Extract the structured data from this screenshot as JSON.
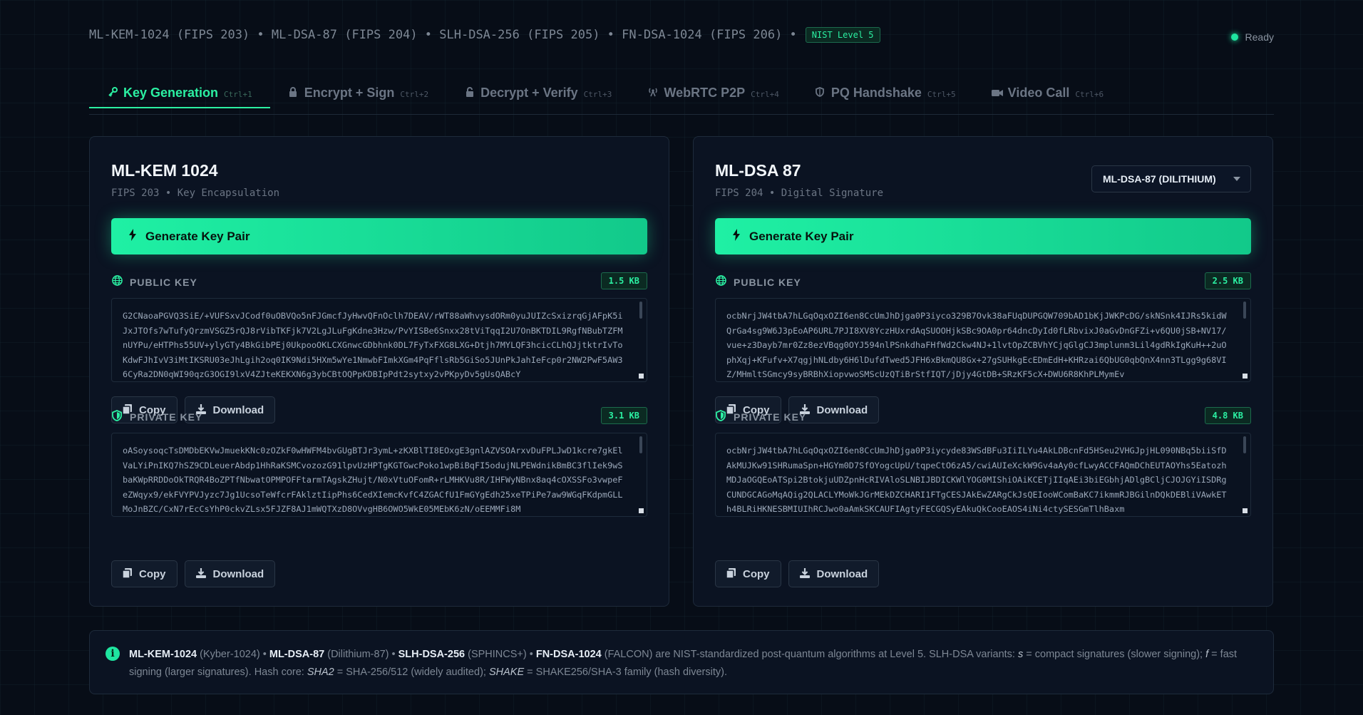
{
  "header": {
    "algorithms_line": "ML-KEM-1024 (FIPS 203) • ML-DSA-87 (FIPS 204) • SLH-DSA-256 (FIPS 205) • FN-DSA-1024 (FIPS 206) •",
    "nist_badge": "NIST Level 5",
    "status": "Ready"
  },
  "tabs": [
    {
      "label": "Key Generation",
      "shortcut": "Ctrl+1",
      "icon": "key-icon"
    },
    {
      "label": "Encrypt + Sign",
      "shortcut": "Ctrl+2",
      "icon": "lock-icon"
    },
    {
      "label": "Decrypt + Verify",
      "shortcut": "Ctrl+3",
      "icon": "unlock-icon"
    },
    {
      "label": "WebRTC P2P",
      "shortcut": "Ctrl+4",
      "icon": "broadcast-icon"
    },
    {
      "label": "PQ Handshake",
      "shortcut": "Ctrl+5",
      "icon": "shield-icon"
    },
    {
      "label": "Video Call",
      "shortcut": "Ctrl+6",
      "icon": "video-icon"
    }
  ],
  "kem": {
    "title": "ML-KEM 1024",
    "subtitle": "FIPS 203 • Key Encapsulation",
    "generate_label": "Generate Key Pair",
    "public_label": "PUBLIC KEY",
    "public_size": "1.5 KB",
    "public_key": "G2CNaoaPGVQ3SiE/+VUFSxvJCodf0uOBVQo5nFJGmcfJyHwvQFnOclh7DEAV/rWT88aWhvysdORm0yuJUIZcSxizrqGjAFpK5iJxJTOfs7wTufyQrzmVSGZ5rQJ8rVibTKFjk7V2LgJLuFgKdne3Hzw/PvYISBe6Snxx28tViTqqI2U7OnBKTDIL9RgfNBubTZFMnUYPu/eHTPhs55UV+ylyGTy4BkGibPEj0UkpooOKLCXGnwcGDbhnk0DL7FyTxFXG8LXG+Dtjh7MYLQF3hcicCLhQJjtktrIvToKdwFJhIvV3iMtIKSRU03eJhLgih2oq0IK9Ndi5HXm5wYe1NmwbFImkXGm4PqFflsRb5GiSo5JUnPkJahIeFcp0r2NW2PwF5AW36CyRa2DN0qWI90qzG3OGI9lxV4ZJteKEKXN6g3ybCBtOQPpKDBIpPdt2sytxy2vPKpyDv5gUsQABcY",
    "private_label": "PRIVATE KEY",
    "private_size": "3.1 KB",
    "private_key": "oASoysoqcTsDMDbEKVwJmuekKNc0zOZkF0wHWFM4bvGUgBTJr3ymL+zKXBlTI8EOxgE3gnlAZVSOArxvDuFPLJwD1kcre7gkElVaLYiPnIKQ7hSZ9CDLeuerAbdp1HhRaKSMCvozozG91lpvUzHPTgKGTGwcPoko1wpBiBqFI5odujNLPEWdnikBmBC3flIek9wSbaKWpRRDDoOkTRQR4BoZPTfNbwatOPMPOFFtarmTAgskZHujt/N0xVtuOFomR+rLMHKVu8R/IHFWyNBnx8aq4cOXSSFo3vwpeFeZWqyx9/ekFVYPVJyzc7Jg1UcsoTeWfcrFAklztIipPhs6CedXIemcKvfC4ZGACfU1FmGYgEdh25xeTPiPe7aw9WGqFKdpmGLLMoJnBZC/CxN7rEcCsYhP0ckvZLsx5FJZF8AJ1mWQTXzD8OVvgHB6OWO5WkE05MEbK6zN/oEEMMFi8M"
  },
  "dsa": {
    "title": "ML-DSA 87",
    "subtitle": "FIPS 204 • Digital Signature",
    "variant_selected": "ML-DSA-87 (DILITHIUM)",
    "generate_label": "Generate Key Pair",
    "public_label": "PUBLIC KEY",
    "public_size": "2.5 KB",
    "public_key": "ocbNrjJW4tbA7hLGqOqxOZI6en8CcUmJhDjga0P3iyco329B7Ovk38aFUqDUPGQW709bAD1bKjJWKPcDG/skNSnk4IJRs5kidWQrGa4sg9W6J3pEoAP6URL7PJI8XV8YczHUxrdAqSUOOHjkSBc9OA0pr64dncDyId0fLRbvixJ0aGvDnGFZi+v6QU0jSB+NV17/vue+z3Dayb7mr0Zz8ezVBqg0OYJ594nlPSnkdhaFHfWd2Ckw4NJ+1lvtOpZCBVhYCjqGlgCJ3mplunm3Lil4gdRkIgKuH++2uOphXqj+KFufv+X7qgjhNLdby6H6lDufdTwed5JFH6xBkmQU8Gx+27gSUHkgEcEDmEdH+KHRzai6QbUG0qbQnX4nn3TLgg9g68VIZ/MHmltSGmcy9syBRBhXiopvwoSMScUzQTiBrStfIQT/jDjy4GtDB+SRzKF5cX+DWU6R8KhPLMymEv",
    "private_label": "PRIVATE KEY",
    "private_size": "4.8 KB",
    "private_key": "ocbNrjJW4tbA7hLGqOqxOZI6en8CcUmJhDjga0P3iycyde83WSdBFu3IiILYu4AkLDBcnFd5HSeu2VHGJpjHL090NBq5biiSfDAkMUJKw91SHRumaSpn+HGYm0D7SfOYogcUpU/tqpeCtO6zA5/cwiAUIeXckW9Gv4aAy0cfLwyACCFAQmDChEUTAOYhs5EatozhMDJaOGQEoATSpi2BtokjuUDZpnHcRIVAloSLNBIJBDICKWlYOG0MIShiOAiKCETjIIqAEi3biEGbhjADlgBCljCJOJGYiISDRgCUNDGCAGoMqAQig2QLACLYMoWkJGrMEkDZCHARI1FTgCESJAkEwZARgCkJsQEIooWComBaKC7ikmmRJBGilnDQkDEBliVAwkETh4BLRiHKNESBMIUIhRCJwo0aAmkSKCAUFIAgtyFECGQSyEAkuQkCooEAOS4iNi4ctySESGmTlhBaxm"
  },
  "buttons": {
    "copy": "Copy",
    "download": "Download"
  },
  "info": {
    "kem_name": "ML-KEM-1024",
    "kem_alias": "(Kyber-1024)",
    "sep1": " • ",
    "dsa_name": "ML-DSA-87",
    "dsa_alias": "(Dilithium-87)",
    "sep2": " • ",
    "slh_name": "SLH-DSA-256",
    "slh_alias": "(SPHINCS+)",
    "sep3": " • ",
    "fn_name": "FN-DSA-1024",
    "fn_alias": "(FALCON)",
    "text1": " are NIST-standardized post-quantum algorithms at Level 5. SLH-DSA variants: ",
    "s_var": "s",
    "text2": " = compact signatures (slower signing); ",
    "f_var": "f",
    "text3": " = fast signing (larger signatures). Hash core: ",
    "sha2": "SHA2",
    "text4": " = SHA-256/512 (widely audited); ",
    "shake": "SHAKE",
    "text5": " = SHAKE256/SHA-3 family (hash diversity)."
  },
  "colors": {
    "accent": "#2bf0a2",
    "background": "#070d17",
    "panel": "#0b1322"
  }
}
